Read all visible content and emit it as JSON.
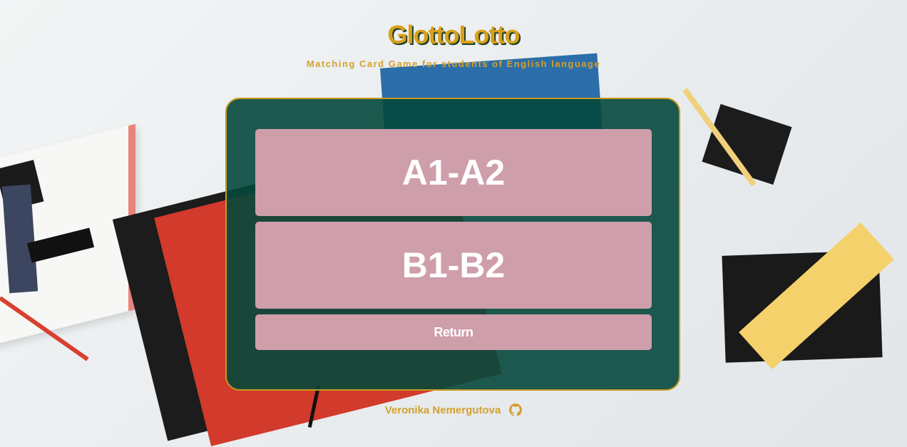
{
  "header": {
    "title": "GlottoLotto",
    "subtitle": "Matching Card Game for students of English language"
  },
  "levels": [
    {
      "label": "A1-A2"
    },
    {
      "label": "B1-B2"
    }
  ],
  "return_label": "Return",
  "footer": {
    "author": "Veronika Nemergutova",
    "icon": "github-icon"
  },
  "colors": {
    "accent": "#d4a02e",
    "panel": "#06483c",
    "button": "#cf9eab",
    "button_text": "#ffffff"
  }
}
